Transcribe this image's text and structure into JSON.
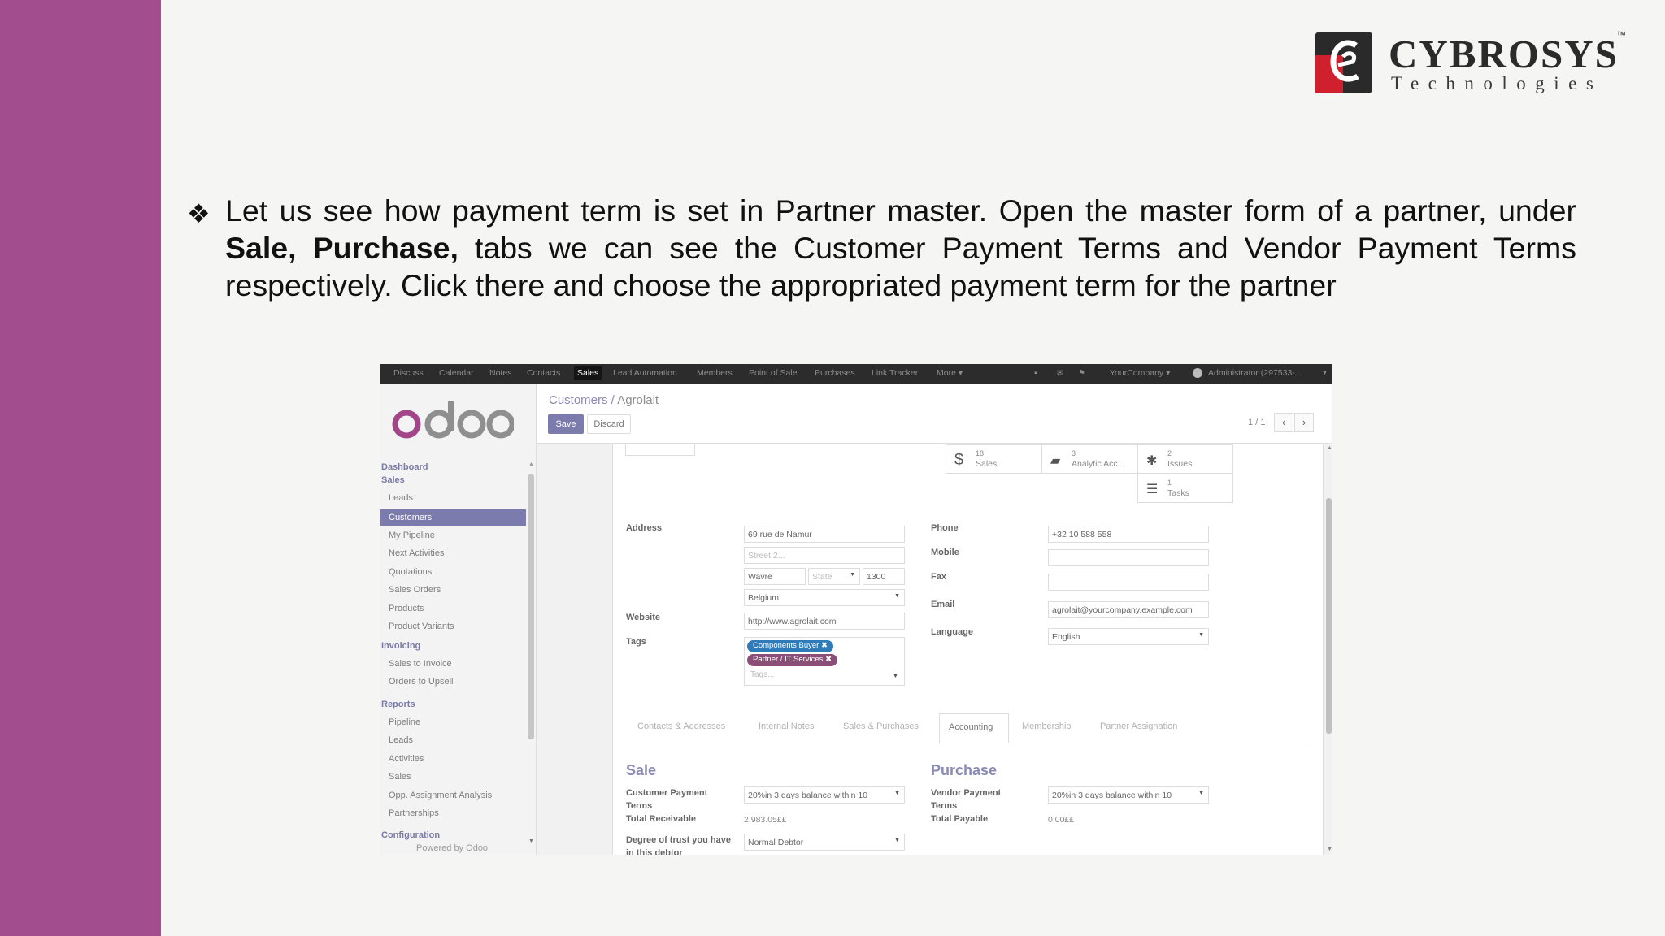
{
  "slide": {
    "brand_name": "CYBROSYS",
    "brand_tm": "™",
    "brand_sub": "Technologies",
    "bullet_glyph": "❖",
    "text_part1": "Let us see how payment term is set in Partner master.  Open the master form of a partner, under ",
    "text_bold": "Sale, Purchase,",
    "text_part2": "  tabs we can see the Customer Payment Terms and Vendor Payment Terms respectively. Click there and choose the appropriated payment term for the partner"
  },
  "colors": {
    "left_bar": "#a24d8d",
    "odoo_accent": "#7c7bad",
    "logo_red": "#d0202e"
  },
  "odoo": {
    "topbar": {
      "menus": [
        "Discuss",
        "Calendar",
        "Notes",
        "Contacts",
        "Sales",
        "Lead Automation",
        "Members",
        "Point of Sale",
        "Purchases",
        "Link Tracker",
        "More ▾"
      ],
      "active_menu": "Sales",
      "company": "YourCompany ▾",
      "user": "Administrator (297533-..."
    },
    "sidebar": {
      "sections": [
        "Dashboard",
        "Sales",
        "Invoicing",
        "Reports",
        "Configuration"
      ],
      "sales_items": [
        "Leads",
        "Customers",
        "My Pipeline",
        "Next Activities",
        "Quotations",
        "Sales Orders",
        "Products",
        "Product Variants"
      ],
      "invoicing_items": [
        "Sales to Invoice",
        "Orders to Upsell"
      ],
      "reports_items": [
        "Pipeline",
        "Leads",
        "Activities",
        "Sales",
        "Opp. Assignment Analysis",
        "Partnerships"
      ],
      "footer": "Powered by Odoo",
      "active_item": "Customers"
    },
    "control_panel": {
      "breadcrumb_parent": "Customers /",
      "breadcrumb_current": "Agrolait",
      "save_label": "Save",
      "discard_label": "Discard",
      "pager": "1 / 1"
    },
    "smart_buttons": [
      {
        "icon": "dollar-icon",
        "count": "18",
        "label": "Sales"
      },
      {
        "icon": "book-icon",
        "count": "3",
        "label": "Analytic Acc..."
      },
      {
        "icon": "bug-icon",
        "count": "2",
        "label": "Issues"
      },
      {
        "icon": "tasks-icon",
        "count": "1",
        "label": "Tasks"
      }
    ],
    "form": {
      "address_label": "Address",
      "street": "69 rue de Namur",
      "street2_placeholder": "Street 2...",
      "city": "Wavre",
      "state_placeholder": "State",
      "zip": "1300",
      "country": "Belgium",
      "website_label": "Website",
      "website": "http://www.agrolait.com",
      "tags_label": "Tags",
      "tags": [
        "Components Buyer",
        "Partner / IT Services"
      ],
      "tags_placeholder": "Tags...",
      "phone_label": "Phone",
      "phone": "+32 10 588 558",
      "mobile_label": "Mobile",
      "fax_label": "Fax",
      "email_label": "Email",
      "email": "agrolait@yourcompany.example.com",
      "language_label": "Language",
      "language": "English"
    },
    "tabs": [
      "Contacts & Addresses",
      "Internal Notes",
      "Sales & Purchases",
      "Accounting",
      "Membership",
      "Partner Assignation"
    ],
    "active_tab": "Accounting",
    "sale": {
      "title": "Sale",
      "payment_terms_label": "Customer Payment Terms",
      "payment_terms": "20%in 3 days balance within 10",
      "receivable_label": "Total Receivable",
      "receivable": "2,983.05££",
      "trust_label": "Degree of trust you have in this debtor",
      "trust": "Normal Debtor"
    },
    "purchase": {
      "title": "Purchase",
      "payment_terms_label": "Vendor Payment Terms",
      "payment_terms": "20%in 3 days balance within 10",
      "payable_label": "Total Payable",
      "payable": "0.00££"
    }
  }
}
